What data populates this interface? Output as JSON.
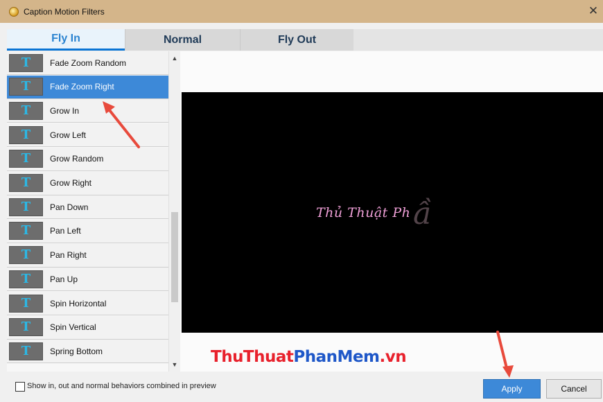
{
  "window": {
    "title": "Caption Motion Filters",
    "close_glyph": "✕"
  },
  "tabs": [
    {
      "label": "Fly In",
      "active": true
    },
    {
      "label": "Normal",
      "active": false
    },
    {
      "label": "Fly Out",
      "active": false
    }
  ],
  "effects": [
    {
      "label": "Fade Zoom Random",
      "icon": "fade-zoom-random-icon",
      "selected": false
    },
    {
      "label": "Fade Zoom Right",
      "icon": "fade-zoom-right-icon",
      "selected": true
    },
    {
      "label": "Grow In",
      "icon": "grow-in-icon",
      "selected": false
    },
    {
      "label": "Grow Left",
      "icon": "grow-left-icon",
      "selected": false
    },
    {
      "label": "Grow Random",
      "icon": "grow-random-icon",
      "selected": false
    },
    {
      "label": "Grow Right",
      "icon": "grow-right-icon",
      "selected": false
    },
    {
      "label": "Pan Down",
      "icon": "pan-down-icon",
      "selected": false
    },
    {
      "label": "Pan Left",
      "icon": "pan-left-icon",
      "selected": false
    },
    {
      "label": "Pan Right",
      "icon": "pan-right-icon",
      "selected": false
    },
    {
      "label": "Pan Up",
      "icon": "pan-up-icon",
      "selected": false
    },
    {
      "label": "Spin Horizontal",
      "icon": "spin-horizontal-icon",
      "selected": false
    },
    {
      "label": "Spin Vertical",
      "icon": "spin-vertical-icon",
      "selected": false
    },
    {
      "label": "Spring Bottom",
      "icon": "spring-bottom-icon",
      "selected": false
    }
  ],
  "preview": {
    "caption_text": "Thủ Thuật Ph",
    "caption_ghost": "ầ"
  },
  "footer": {
    "combine_label": "Show in, out and normal behaviors combined in preview",
    "combine_checked": false,
    "apply_label": "Apply",
    "cancel_label": "Cancel"
  },
  "watermark": {
    "part1": "ThuThuat",
    "part2": "PhanMem",
    "part3": ".vn"
  },
  "colors": {
    "accent": "#3d89d8",
    "titlebar": "#d4b58a",
    "annotation_arrow": "#e84a3c"
  }
}
